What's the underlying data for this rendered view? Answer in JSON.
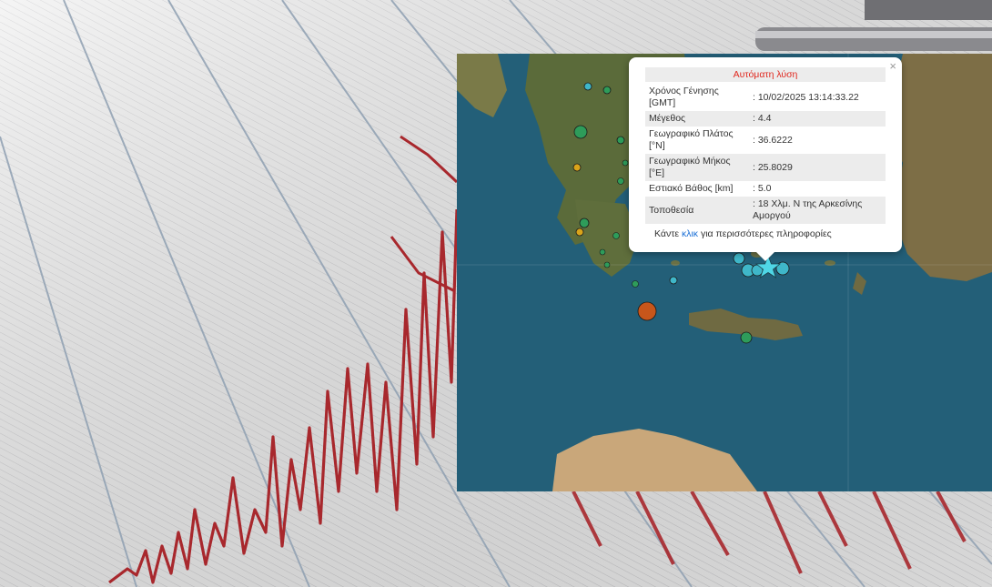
{
  "colors": {
    "trace": "#a8282d",
    "paper": "#ececec",
    "grid": "#8fa0b2",
    "sea": "#1f5f78",
    "land": "#5b6b3a",
    "popup_title": "#e0281f",
    "link": "#1a6fd6"
  },
  "map": {
    "markers": [
      {
        "color": "#3fb7c9"
      },
      {
        "color": "#3fb7c9"
      },
      {
        "color": "#3fb7c9"
      },
      {
        "color": "#3fb7c9"
      },
      {
        "color": "#3fb7c9"
      },
      {
        "color": "#2e9c5a"
      },
      {
        "color": "#2e9c5a"
      },
      {
        "color": "#2e9c5a"
      },
      {
        "color": "#2e9c5a"
      },
      {
        "color": "#d9a41a"
      },
      {
        "color": "#d9a41a"
      },
      {
        "color": "#c7561b"
      },
      {
        "color": "#2e9c5a"
      },
      {
        "color": "#3fb7c9"
      }
    ],
    "epicenter_icon": "star-icon"
  },
  "popup": {
    "title": "Αυτόματη λύση",
    "close_icon": "×",
    "rows": [
      {
        "label": "Χρόνος Γένησης [GMT]",
        "value": ": 10/02/2025 13:14:33.22"
      },
      {
        "label": "Μέγεθος",
        "value": ": 4.4"
      },
      {
        "label": "Γεωγραφικό Πλάτος [°N]",
        "value": ": 36.6222"
      },
      {
        "label": "Γεωγραφικό Μήκος [°E]",
        "value": ": 25.8029"
      },
      {
        "label": "Εστιακό Βάθος [km]",
        "value": ": 5.0"
      },
      {
        "label": "Τοποθεσία",
        "value": ": 18 Χλμ. Ν της Αρκεσίνης Αμοργού"
      }
    ],
    "more_prefix": "Κάντε ",
    "more_link": "κλικ",
    "more_suffix": " για περισσότερες πληροφορίες"
  }
}
